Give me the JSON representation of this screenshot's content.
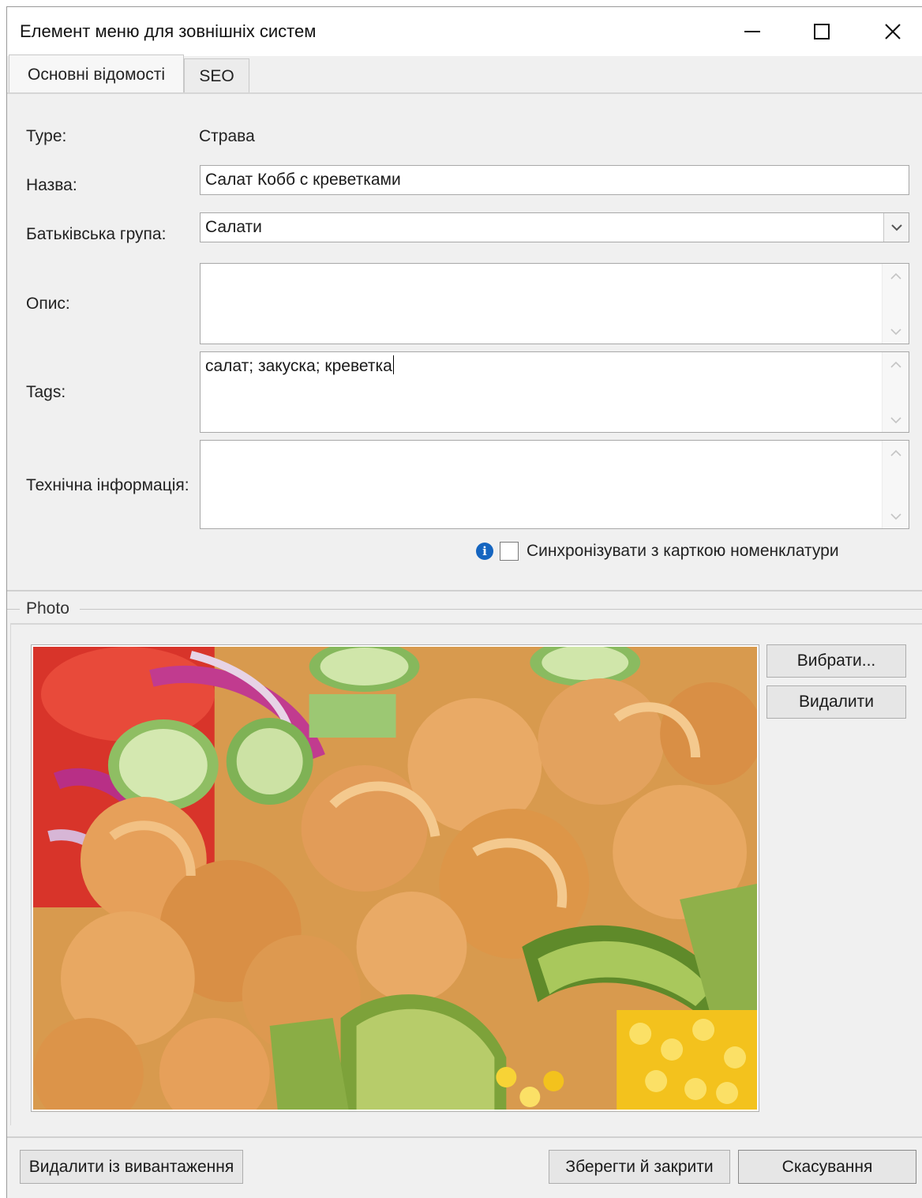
{
  "window": {
    "title": "Елемент меню для зовнішніх систем",
    "controls": {
      "minimize": "minimize-icon",
      "maximize": "maximize-icon",
      "close": "close-icon"
    }
  },
  "tabs": [
    {
      "label": "Основні відомості",
      "active": true
    },
    {
      "label": "SEO",
      "active": false
    }
  ],
  "form": {
    "type_label": "Type:",
    "type_value": "Страва",
    "name_label": "Назва:",
    "name_value": "Салат Кобб с креветками",
    "parent_label": "Батьківська група:",
    "parent_value": "Салати",
    "description_label": "Опис:",
    "description_value": "",
    "tags_label": "Tags:",
    "tags_value": "салат; закуска; креветка",
    "tech_label": "Технічна інформація:",
    "tech_value": "",
    "sync_label": "Синхронізувати з карткою номенклатури",
    "sync_checked": false
  },
  "photo": {
    "group_title": "Photo",
    "select_button": "Вибрати...",
    "delete_button": "Видалити"
  },
  "footer": {
    "remove_button": "Видалити із вивантаження",
    "save_button": "Зберегти й закрити",
    "cancel_button": "Скасування"
  },
  "colors": {
    "window_bg": "#f0f0f0",
    "info_icon": "#1565c0"
  }
}
